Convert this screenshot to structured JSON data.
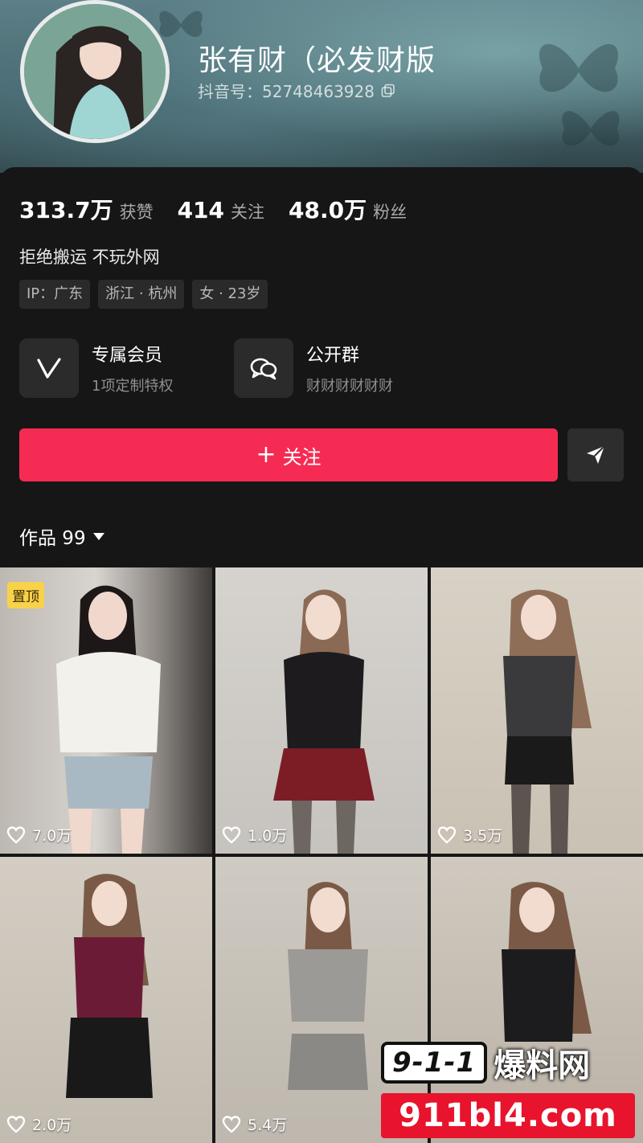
{
  "profile": {
    "name": "张有财（必发财版",
    "douyin_id": "抖音号：52748463928",
    "bio": "拒绝搬运 不玩外网"
  },
  "stats": [
    {
      "value": "313.7万",
      "label": "获赞"
    },
    {
      "value": "414",
      "label": "关注"
    },
    {
      "value": "48.0万",
      "label": "粉丝"
    }
  ],
  "tags": [
    "IP：广东",
    "浙江 · 杭州",
    "女 · 23岁"
  ],
  "features": {
    "membership": {
      "title": "专属会员",
      "subtitle": "1项定制特权",
      "icon": "v-icon"
    },
    "group": {
      "title": "公开群",
      "subtitle": "财财财财财财",
      "icon": "chat-bubbles-icon"
    }
  },
  "actions": {
    "follow_label": "关注",
    "follow_plus": "+",
    "share_icon": "send-icon"
  },
  "works": {
    "label": "作品 99"
  },
  "videos": [
    {
      "likes": "7.0万",
      "pinned": "置顶"
    },
    {
      "likes": "1.0万"
    },
    {
      "likes": "3.5万"
    },
    {
      "likes": "2.0万"
    },
    {
      "likes": "5.4万"
    },
    {
      "likes": ""
    }
  ],
  "watermark": {
    "badge": "9-1-1",
    "text": "爆料网",
    "url": "911bl4.com"
  },
  "colors": {
    "accent": "#f52b54",
    "background": "#161616",
    "pin": "#f7d24a"
  }
}
